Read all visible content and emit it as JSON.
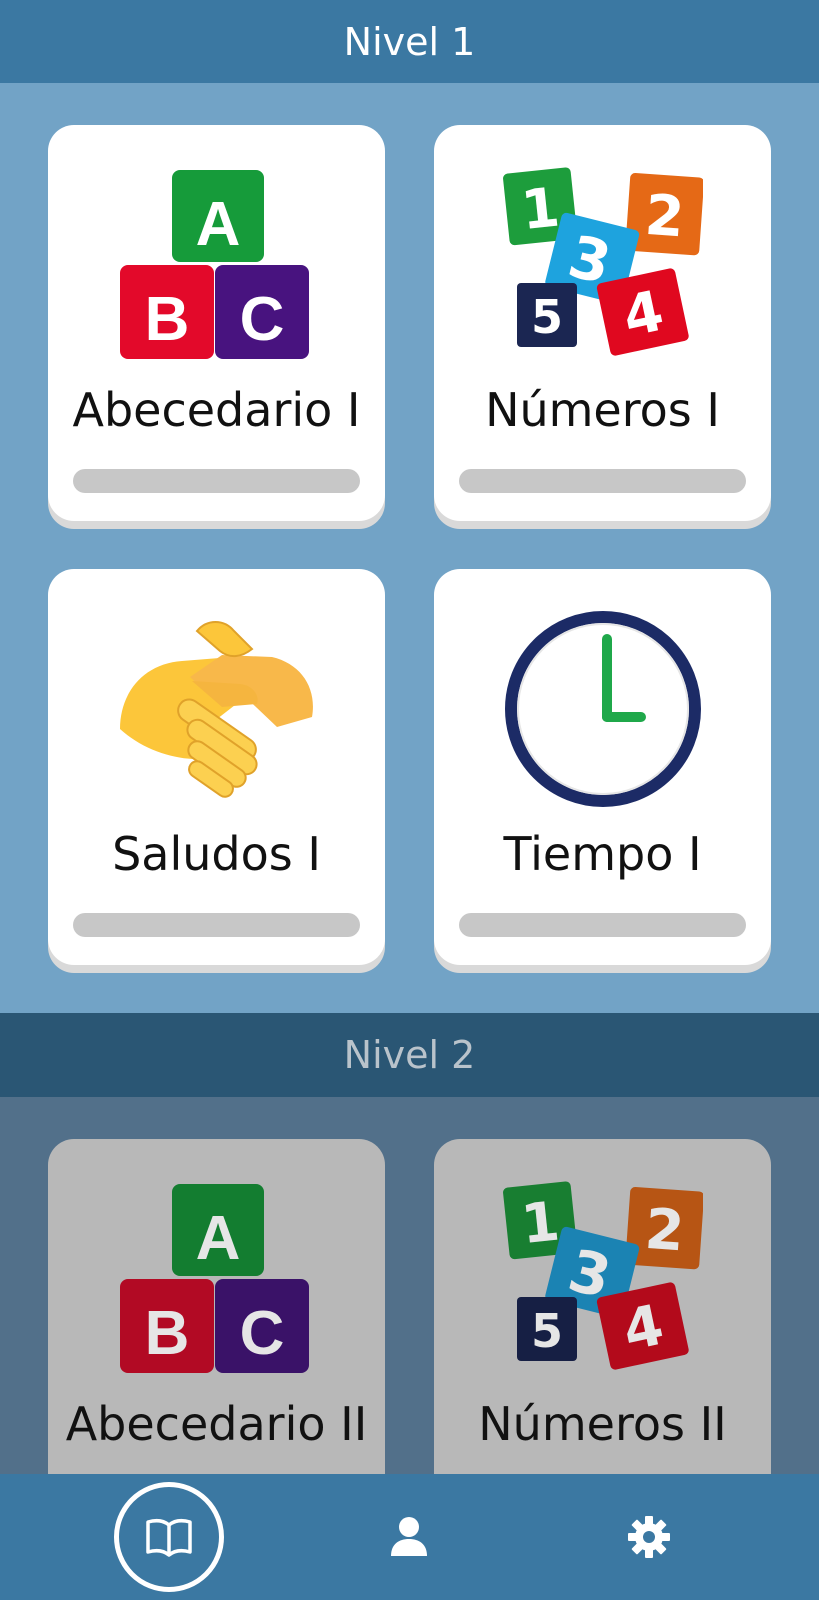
{
  "levels": [
    {
      "title": "Nivel 1",
      "lessons": [
        {
          "label": "Abecedario I",
          "icon": "abc-blocks-icon",
          "progress": 0
        },
        {
          "label": "Números I",
          "icon": "number-blocks-icon",
          "progress": 0
        },
        {
          "label": "Saludos I",
          "icon": "handshake-icon",
          "progress": 0
        },
        {
          "label": "Tiempo I",
          "icon": "clock-icon",
          "progress": 0
        }
      ]
    },
    {
      "title": "Nivel 2",
      "locked": true,
      "lessons": [
        {
          "label": "Abecedario II",
          "icon": "abc-blocks-icon"
        },
        {
          "label": "Números II",
          "icon": "number-blocks-icon"
        }
      ]
    }
  ],
  "nav": {
    "items": [
      {
        "icon": "book-icon",
        "active": true
      },
      {
        "icon": "user-icon",
        "active": false
      },
      {
        "icon": "gear-icon",
        "active": false
      }
    ]
  },
  "colors": {
    "header": "#3b78a2",
    "level1_bg": "#72a3c6",
    "level2_header": "#2a5674",
    "level2_bg": "#52708a",
    "card": "#ffffff",
    "card_locked": "#b8b8b8",
    "progress_track": "#c7c7c7"
  }
}
